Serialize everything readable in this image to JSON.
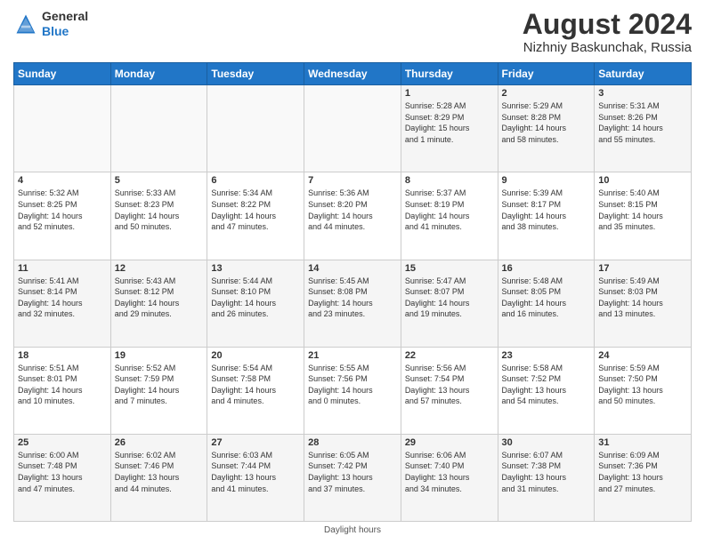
{
  "header": {
    "logo_general": "General",
    "logo_blue": "Blue",
    "month_title": "August 2024",
    "location": "Nizhniy Baskunchak, Russia"
  },
  "days_of_week": [
    "Sunday",
    "Monday",
    "Tuesday",
    "Wednesday",
    "Thursday",
    "Friday",
    "Saturday"
  ],
  "footer": {
    "label": "Daylight hours"
  },
  "weeks": [
    [
      {
        "day": "",
        "info": ""
      },
      {
        "day": "",
        "info": ""
      },
      {
        "day": "",
        "info": ""
      },
      {
        "day": "",
        "info": ""
      },
      {
        "day": "1",
        "info": "Sunrise: 5:28 AM\nSunset: 8:29 PM\nDaylight: 15 hours\nand 1 minute."
      },
      {
        "day": "2",
        "info": "Sunrise: 5:29 AM\nSunset: 8:28 PM\nDaylight: 14 hours\nand 58 minutes."
      },
      {
        "day": "3",
        "info": "Sunrise: 5:31 AM\nSunset: 8:26 PM\nDaylight: 14 hours\nand 55 minutes."
      }
    ],
    [
      {
        "day": "4",
        "info": "Sunrise: 5:32 AM\nSunset: 8:25 PM\nDaylight: 14 hours\nand 52 minutes."
      },
      {
        "day": "5",
        "info": "Sunrise: 5:33 AM\nSunset: 8:23 PM\nDaylight: 14 hours\nand 50 minutes."
      },
      {
        "day": "6",
        "info": "Sunrise: 5:34 AM\nSunset: 8:22 PM\nDaylight: 14 hours\nand 47 minutes."
      },
      {
        "day": "7",
        "info": "Sunrise: 5:36 AM\nSunset: 8:20 PM\nDaylight: 14 hours\nand 44 minutes."
      },
      {
        "day": "8",
        "info": "Sunrise: 5:37 AM\nSunset: 8:19 PM\nDaylight: 14 hours\nand 41 minutes."
      },
      {
        "day": "9",
        "info": "Sunrise: 5:39 AM\nSunset: 8:17 PM\nDaylight: 14 hours\nand 38 minutes."
      },
      {
        "day": "10",
        "info": "Sunrise: 5:40 AM\nSunset: 8:15 PM\nDaylight: 14 hours\nand 35 minutes."
      }
    ],
    [
      {
        "day": "11",
        "info": "Sunrise: 5:41 AM\nSunset: 8:14 PM\nDaylight: 14 hours\nand 32 minutes."
      },
      {
        "day": "12",
        "info": "Sunrise: 5:43 AM\nSunset: 8:12 PM\nDaylight: 14 hours\nand 29 minutes."
      },
      {
        "day": "13",
        "info": "Sunrise: 5:44 AM\nSunset: 8:10 PM\nDaylight: 14 hours\nand 26 minutes."
      },
      {
        "day": "14",
        "info": "Sunrise: 5:45 AM\nSunset: 8:08 PM\nDaylight: 14 hours\nand 23 minutes."
      },
      {
        "day": "15",
        "info": "Sunrise: 5:47 AM\nSunset: 8:07 PM\nDaylight: 14 hours\nand 19 minutes."
      },
      {
        "day": "16",
        "info": "Sunrise: 5:48 AM\nSunset: 8:05 PM\nDaylight: 14 hours\nand 16 minutes."
      },
      {
        "day": "17",
        "info": "Sunrise: 5:49 AM\nSunset: 8:03 PM\nDaylight: 14 hours\nand 13 minutes."
      }
    ],
    [
      {
        "day": "18",
        "info": "Sunrise: 5:51 AM\nSunset: 8:01 PM\nDaylight: 14 hours\nand 10 minutes."
      },
      {
        "day": "19",
        "info": "Sunrise: 5:52 AM\nSunset: 7:59 PM\nDaylight: 14 hours\nand 7 minutes."
      },
      {
        "day": "20",
        "info": "Sunrise: 5:54 AM\nSunset: 7:58 PM\nDaylight: 14 hours\nand 4 minutes."
      },
      {
        "day": "21",
        "info": "Sunrise: 5:55 AM\nSunset: 7:56 PM\nDaylight: 14 hours\nand 0 minutes."
      },
      {
        "day": "22",
        "info": "Sunrise: 5:56 AM\nSunset: 7:54 PM\nDaylight: 13 hours\nand 57 minutes."
      },
      {
        "day": "23",
        "info": "Sunrise: 5:58 AM\nSunset: 7:52 PM\nDaylight: 13 hours\nand 54 minutes."
      },
      {
        "day": "24",
        "info": "Sunrise: 5:59 AM\nSunset: 7:50 PM\nDaylight: 13 hours\nand 50 minutes."
      }
    ],
    [
      {
        "day": "25",
        "info": "Sunrise: 6:00 AM\nSunset: 7:48 PM\nDaylight: 13 hours\nand 47 minutes."
      },
      {
        "day": "26",
        "info": "Sunrise: 6:02 AM\nSunset: 7:46 PM\nDaylight: 13 hours\nand 44 minutes."
      },
      {
        "day": "27",
        "info": "Sunrise: 6:03 AM\nSunset: 7:44 PM\nDaylight: 13 hours\nand 41 minutes."
      },
      {
        "day": "28",
        "info": "Sunrise: 6:05 AM\nSunset: 7:42 PM\nDaylight: 13 hours\nand 37 minutes."
      },
      {
        "day": "29",
        "info": "Sunrise: 6:06 AM\nSunset: 7:40 PM\nDaylight: 13 hours\nand 34 minutes."
      },
      {
        "day": "30",
        "info": "Sunrise: 6:07 AM\nSunset: 7:38 PM\nDaylight: 13 hours\nand 31 minutes."
      },
      {
        "day": "31",
        "info": "Sunrise: 6:09 AM\nSunset: 7:36 PM\nDaylight: 13 hours\nand 27 minutes."
      }
    ]
  ]
}
